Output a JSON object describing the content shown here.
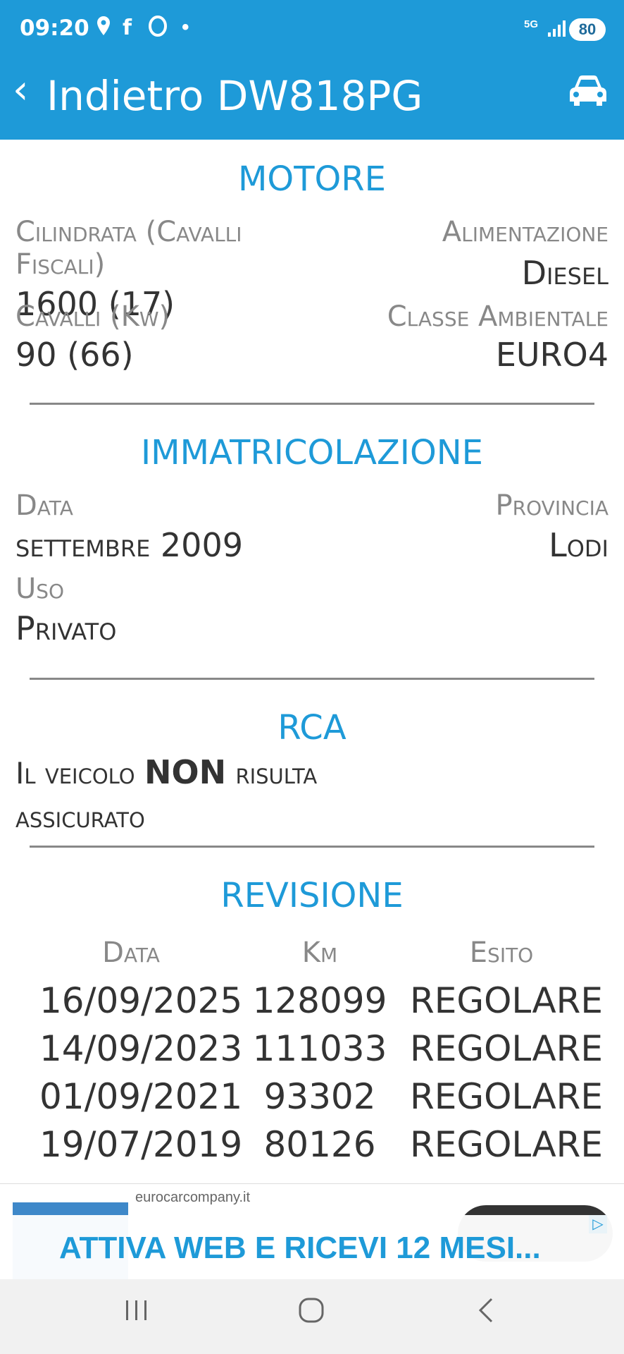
{
  "status_bar": {
    "time": "09:20",
    "network": "5G",
    "battery": "80"
  },
  "header": {
    "back_label": "Indietro",
    "plate": "DW818PG"
  },
  "motore": {
    "title": "MOTORE",
    "cilindrata_label": "Cilindrata (Cavalli Fiscali)",
    "cilindrata_value": "1600 (17)",
    "alimentazione_label": "Alimentazione",
    "alimentazione_value": "Diesel",
    "cavalli_label": "Cavalli (Kw)",
    "cavalli_value": "90 (66)",
    "classe_label": "Classe Ambientale",
    "classe_value": "EURO4"
  },
  "immatricolazione": {
    "title": "IMMATRICOLAZIONE",
    "data_label": "Data",
    "data_value": "settembre 2009",
    "provincia_label": "Provincia",
    "provincia_value": "Lodi",
    "uso_label": "Uso",
    "uso_value": "Privato"
  },
  "rca": {
    "title": "RCA",
    "text_before": "Il veicolo ",
    "text_bold": "NON",
    "text_after": " risulta assicurato"
  },
  "revisione": {
    "title": "REVISIONE",
    "headers": [
      "Data",
      "Km",
      "Esito"
    ],
    "rows": [
      [
        "16/09/2025",
        "128099",
        "REGOLARE"
      ],
      [
        "14/09/2023",
        "111033",
        "REGOLARE"
      ],
      [
        "01/09/2021",
        "93302",
        "REGOLARE"
      ],
      [
        "19/07/2019",
        "80126",
        "REGOLARE"
      ]
    ]
  },
  "ad": {
    "domain": "eurocarcompany.it",
    "text": "ATTIVA WEB E RICEVI 12 MESI..."
  },
  "colors": {
    "primary": "#1e9ad8",
    "label_gray": "#888888",
    "value_dark": "#333333"
  }
}
